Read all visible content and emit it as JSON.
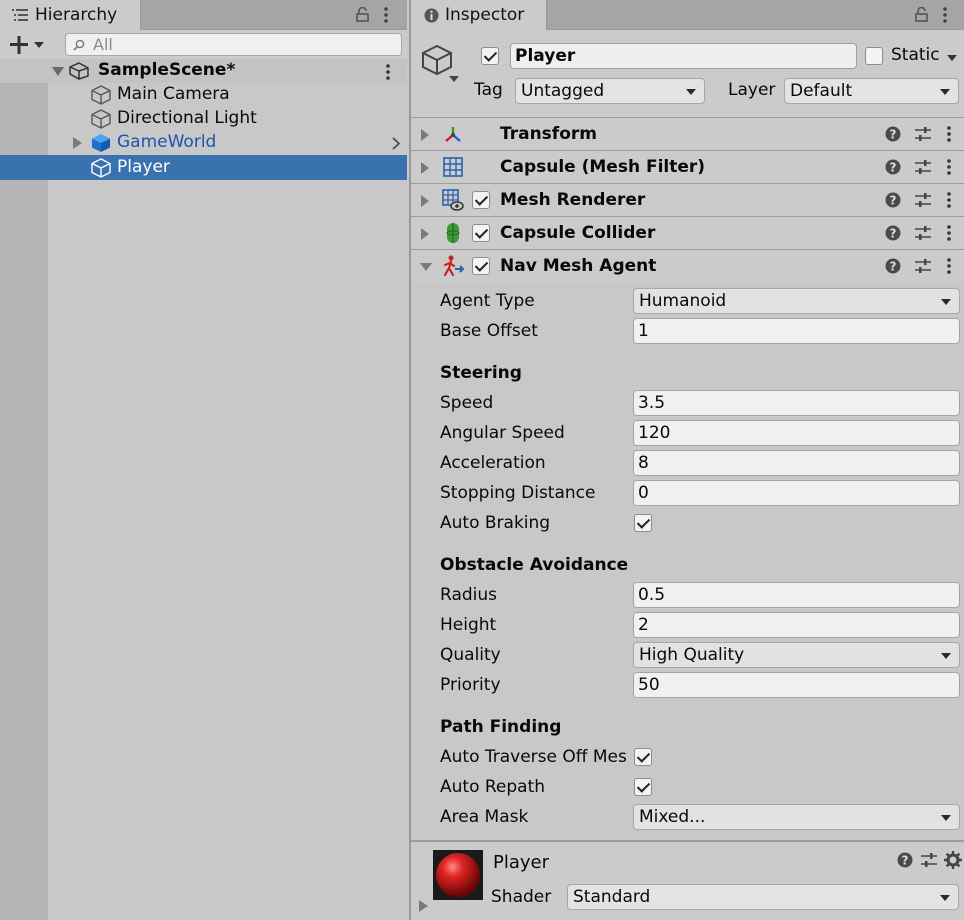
{
  "hierarchy": {
    "tab_label": "Hierarchy",
    "search_placeholder": "All",
    "scene_name": "SampleScene*",
    "items": [
      {
        "label": "Main Camera"
      },
      {
        "label": "Directional Light"
      },
      {
        "label": "GameWorld"
      },
      {
        "label": "Player"
      }
    ]
  },
  "inspector": {
    "tab_label": "Inspector",
    "object_name": "Player",
    "static_label": "Static",
    "tag_label": "Tag",
    "tag_value": "Untagged",
    "layer_label": "Layer",
    "layer_value": "Default",
    "components": [
      {
        "title": "Transform"
      },
      {
        "title": "Capsule (Mesh Filter)"
      },
      {
        "title": "Mesh Renderer"
      },
      {
        "title": "Capsule Collider"
      },
      {
        "title": "Nav Mesh Agent"
      }
    ],
    "nav_mesh_agent": {
      "agent_type_label": "Agent Type",
      "agent_type_value": "Humanoid",
      "base_offset_label": "Base Offset",
      "base_offset_value": "1",
      "steering_header": "Steering",
      "speed_label": "Speed",
      "speed_value": "3.5",
      "angular_speed_label": "Angular Speed",
      "angular_speed_value": "120",
      "acceleration_label": "Acceleration",
      "acceleration_value": "8",
      "stopping_distance_label": "Stopping Distance",
      "stopping_distance_value": "0",
      "auto_braking_label": "Auto Braking",
      "obstacle_header": "Obstacle Avoidance",
      "radius_label": "Radius",
      "radius_value": "0.5",
      "height_label": "Height",
      "height_value": "2",
      "quality_label": "Quality",
      "quality_value": "High Quality",
      "priority_label": "Priority",
      "priority_value": "50",
      "path_header": "Path Finding",
      "auto_traverse_label": "Auto Traverse Off Mes",
      "auto_repath_label": "Auto Repath",
      "area_mask_label": "Area Mask",
      "area_mask_value": "Mixed..."
    },
    "material": {
      "name": "Player",
      "shader_label": "Shader",
      "shader_value": "Standard"
    }
  },
  "colors": {
    "selection": "#3a72b0",
    "prefab_text": "#1c54b0",
    "material_red": "#d01818"
  }
}
